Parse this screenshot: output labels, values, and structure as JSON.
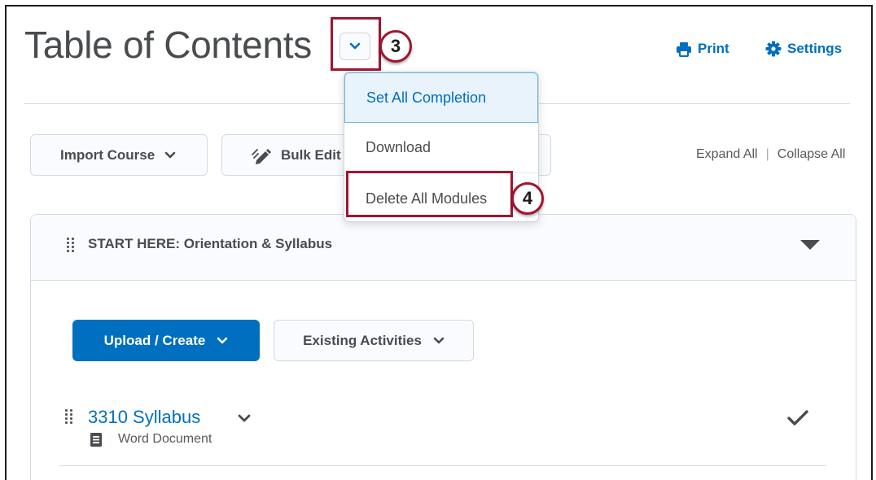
{
  "header": {
    "title": "Table of Contents",
    "print_label": "Print",
    "settings_label": "Settings"
  },
  "callouts": {
    "step_a": "3",
    "step_b": "4"
  },
  "toolbar": {
    "import_label": "Import Course",
    "bulk_edit_label": "Bulk Edit",
    "expand_all": "Expand All",
    "separator": "|",
    "collapse_all": "Collapse All"
  },
  "dropdown": {
    "items": [
      {
        "label": "Set All Completion"
      },
      {
        "label": "Download"
      },
      {
        "label": "Delete All Modules"
      }
    ]
  },
  "module": {
    "title": "START HERE: Orientation & Syllabus",
    "upload_label": "Upload / Create",
    "existing_label": "Existing Activities",
    "items": [
      {
        "title": "3310 Syllabus",
        "type": "Word Document"
      }
    ]
  },
  "colors": {
    "accent": "#006fbf",
    "callout": "#a0152f",
    "text": "#494c4e"
  }
}
